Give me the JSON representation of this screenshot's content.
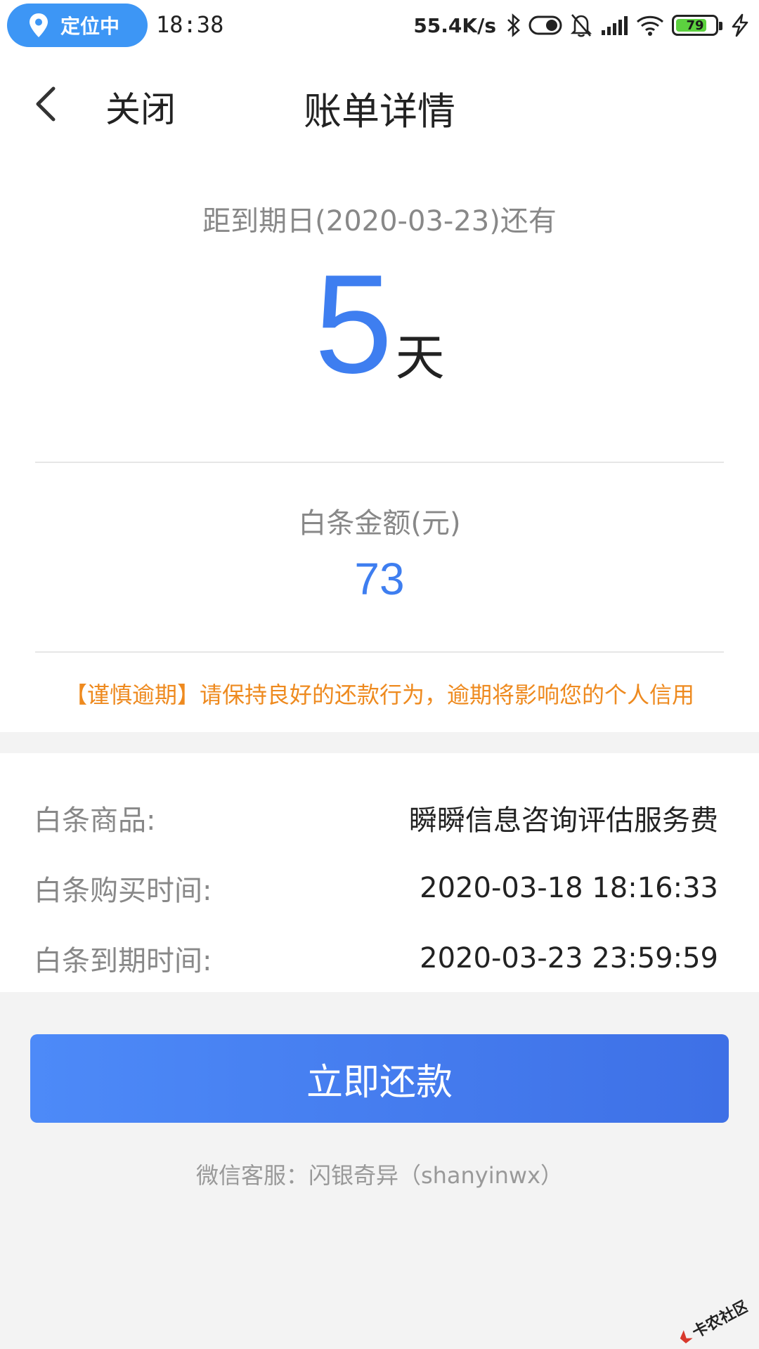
{
  "status_bar": {
    "location_pill": "定位中",
    "time": "18:38",
    "net_speed": "55.4K/s",
    "battery_level": "79",
    "battery_fraction": 0.79
  },
  "nav": {
    "close_label": "关闭",
    "title": "账单详情"
  },
  "summary": {
    "due_text": "距到期日(2020-03-23)还有",
    "days": "5",
    "days_unit": "天",
    "amount_label": "白条金额(元)",
    "amount": "73",
    "warning": "【谨慎逾期】请保持良好的还款行为，逾期将影响您的个人信用"
  },
  "details": [
    {
      "label": "白条商品:",
      "value": "瞬瞬信息咨询评估服务费"
    },
    {
      "label": "白条购买时间:",
      "value": "2020-03-18 18:16:33"
    },
    {
      "label": "白条到期时间:",
      "value": "2020-03-23 23:59:59"
    }
  ],
  "actions": {
    "pay_label": "立即还款"
  },
  "footer": {
    "service_text": "微信客服：闪银奇异（shanyinwx）"
  },
  "watermark": {
    "text": "卡农社区"
  },
  "colors": {
    "accent": "#3e7ef0",
    "warning": "#ee8a1f",
    "pill": "#3d96f5",
    "battery": "#5cd13f"
  },
  "icons": [
    "location-pin-icon",
    "bluetooth-icon",
    "toggle-icon",
    "bell-off-icon",
    "signal-icon",
    "wifi-icon",
    "battery-icon",
    "charging-icon",
    "back-arrow-icon"
  ]
}
